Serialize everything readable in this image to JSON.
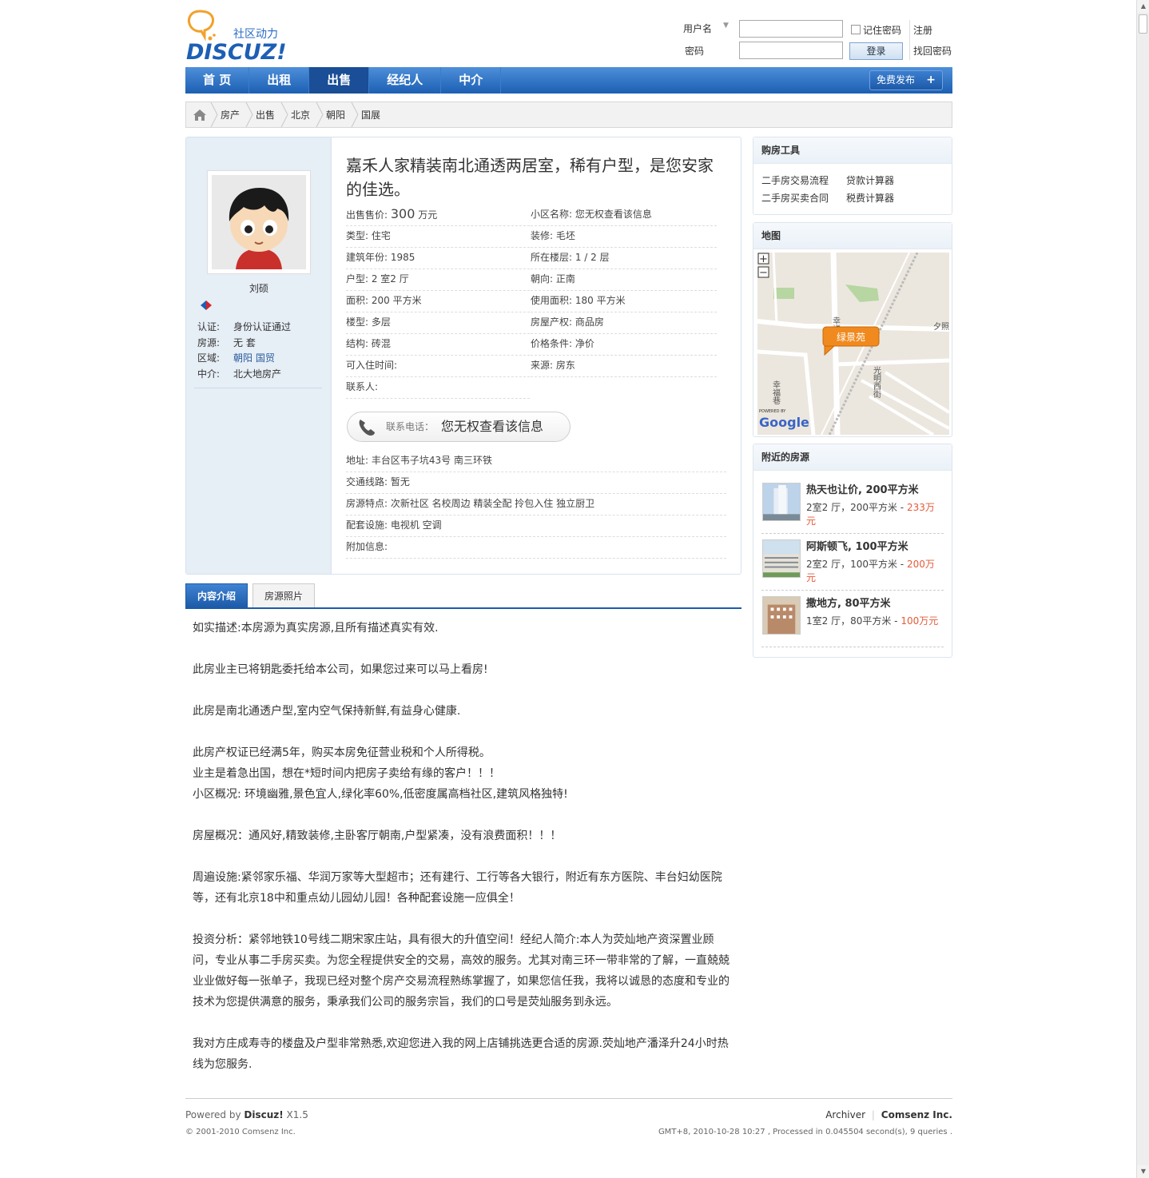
{
  "login": {
    "username_label": "用户名",
    "password_label": "密码",
    "remember_label": "记住密码",
    "register_link": "注册",
    "login_button": "登录",
    "forgot_link": "找回密码"
  },
  "logo": {
    "tagline": "社区动力",
    "wordmark": "DISCUZ!"
  },
  "nav": {
    "items": [
      "首 页",
      "出租",
      "出售",
      "经纪人",
      "中介"
    ],
    "active": "出售",
    "post_button": "免费发布",
    "post_plus": "+"
  },
  "breadcrumb": [
    "房产",
    "出售",
    "北京",
    "朝阳",
    "国展"
  ],
  "agent": {
    "name": "刘硕",
    "rows": [
      {
        "k": "认证:",
        "v": "身份认证通过"
      },
      {
        "k": "房源:",
        "v": "无 套"
      },
      {
        "k": "区域:",
        "v": "朝阳 国贸"
      },
      {
        "k": "中介:",
        "v": "北大地房产"
      }
    ]
  },
  "listing": {
    "title": "嘉禾人家精装南北通透两居室，稀有户型，是您安家的佳选。",
    "price_label": "出售售价:",
    "price_value": "300",
    "price_unit": "万元",
    "left": [
      "类型: 住宅",
      "建筑年份: 1985",
      "户型: 2 室2 厅",
      "面积: 200 平方米",
      "楼型: 多层",
      "结构: 砖混",
      "可入住时间:",
      "联系人:"
    ],
    "right": [
      "小区名称: 您无权查看该信息",
      "装修: 毛坯",
      "所在楼层: 1 / 2 层",
      "朝向: 正南",
      "使用面积: 180 平方米",
      "房屋产权: 商品房",
      "价格条件: 净价",
      "来源: 房东"
    ],
    "phone_label": "联系电话：",
    "phone_value": "您无权查看该信息",
    "extra": [
      "地址: 丰台区韦子坑43号 南三环铁",
      "交通线路: 暂无",
      "房源特点: 次新社区 名校周边 精装全配 拎包入住 独立厨卫",
      "配套设施: 电视机 空调",
      "附加信息:"
    ]
  },
  "tabs": [
    "内容介绍",
    "房源照片"
  ],
  "description": [
    "如实描述:本房源为真实房源,且所有描述真实有效.",
    "",
    "此房业主已将钥匙委托给本公司，如果您过来可以马上看房!",
    "",
    "此房是南北通透户型,室内空气保持新鲜,有益身心健康.",
    "",
    "此房产权证已经满5年，购买本房免征营业税和个人所得税。",
    "业主是着急出国，想在*短时间内把房子卖给有缘的客户！！！",
    "小区概况: 环境幽雅,景色宜人,绿化率60%,低密度属高档社区,建筑风格独特!",
    "",
    "房屋概况：通风好,精致装修,主卧客厅朝南,户型紧凑，没有浪费面积！！！",
    "",
    "周遍设施:紧邻家乐福、华润万家等大型超市；还有建行、工行等各大银行，附近有东方医院、丰台妇幼医院等，还有北京18中和重点幼儿园幼儿园！各种配套设施一应俱全！",
    "",
    "投资分析：紧邻地铁10号线二期宋家庄站，具有很大的升值空间！经纪人简介:本人为荧灿地产资深置业顾问，专业从事二手房买卖。为您全程提供安全的交易，高效的服务。尤其对南三环一带非常的了解，一直兢兢业业做好每一张单子，我现已经对整个房产交易流程熟练掌握了，如果您信任我，我将以诚恳的态度和专业的技术为您提供满意的服务，秉承我们公司的服务宗旨，我们的口号是荧灿服务到永远。",
    "",
    "我对方庄成寿寺的楼盘及户型非常熟悉,欢迎您进入我的网上店铺挑选更合适的房源.荧灿地产潘泽升24小时热线为您服务."
  ],
  "tools": {
    "title": "购房工具",
    "items": [
      "二手房交易流程",
      "贷款计算器",
      "二手房买卖合同",
      "税费计算器"
    ]
  },
  "map": {
    "title": "地图",
    "marker": "绿景苑",
    "streets": [
      "幸福",
      "幸福巷",
      "光明西街",
      "夕照"
    ],
    "zoom_in": "+",
    "zoom_out": "−",
    "powered": "POWERED BY",
    "google": "Google"
  },
  "nearby": {
    "title": "附近的房源",
    "items": [
      {
        "title": "热天也让价, 200平方米",
        "desc": "2室2 厅，200平方米 - ",
        "price": "233万元"
      },
      {
        "title": "阿斯顿飞, 100平方米",
        "desc": "2室2 厅，100平方米 - ",
        "price": "200万元"
      },
      {
        "title": "撒地方, 80平方米",
        "desc": "1室2 厅，80平方米 - ",
        "price": "100万元"
      }
    ]
  },
  "footer": {
    "powered": "Powered by ",
    "brand": "Discuz!",
    "version": " X1.5",
    "copyright": "© 2001-2010 Comsenz Inc.",
    "archiver": "Archiver",
    "sep": "|",
    "company": "Comsenz Inc.",
    "stats": "GMT+8, 2010-10-28 10:27 , Processed in 0.045504 second(s), 9 queries ."
  },
  "colors": {
    "nav": "#1c5fb3",
    "price_red": "#e25b3a",
    "link_blue": "#2b5b9c"
  }
}
